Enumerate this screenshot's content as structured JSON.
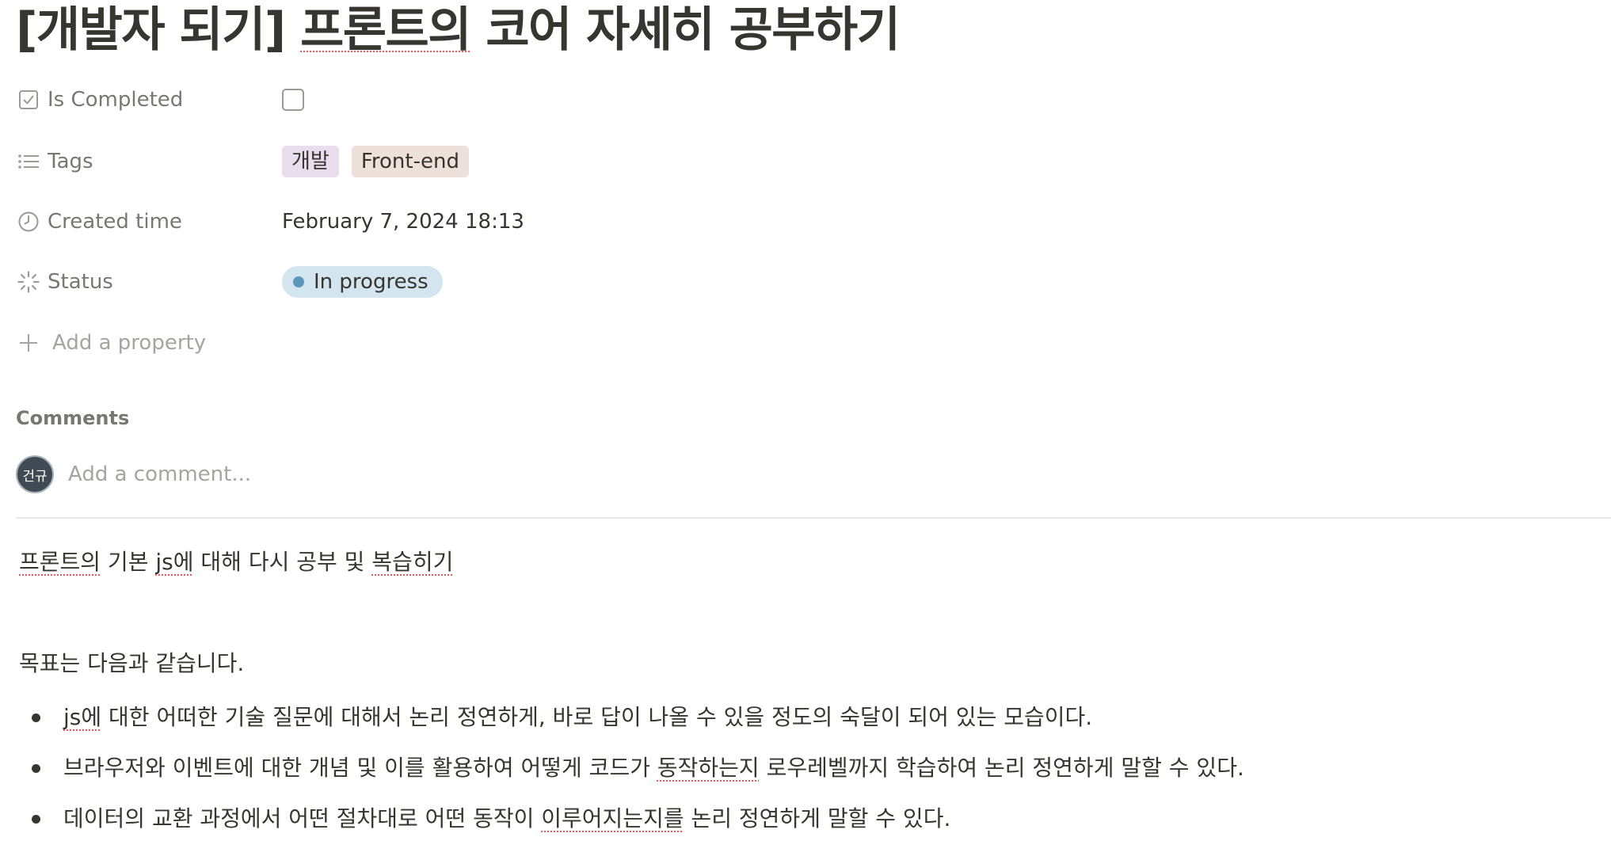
{
  "title": {
    "bracket": "[개발자 되기] ",
    "word_spell": "프론트의",
    "rest": " 코어 자세히 공부하기"
  },
  "properties": [
    {
      "name": "Is Completed",
      "icon": "checkbox-icon",
      "type": "checkbox",
      "checked": false
    },
    {
      "name": "Tags",
      "icon": "list-icon",
      "type": "multi_select",
      "tags": [
        {
          "label": "개발",
          "bg": "#e8deee"
        },
        {
          "label": "Front-end",
          "bg": "#eee0da"
        }
      ]
    },
    {
      "name": "Created time",
      "icon": "clock-icon",
      "type": "created_time",
      "value": "February 7, 2024 18:13"
    },
    {
      "name": "Status",
      "icon": "status-icon",
      "type": "status",
      "value": "In progress",
      "bg": "#d3e5ef",
      "dot_color": "#5b97bd"
    }
  ],
  "add_property_label": "Add a property",
  "comments": {
    "label": "Comments",
    "avatar_initials": "건규",
    "placeholder": "Add a comment..."
  },
  "body": {
    "line1": {
      "spell1": "프론트의",
      "t1": " 기본 ",
      "spell2": "js에",
      "t2": " 대해 다시 공부 및 ",
      "spell3": "복습히기"
    },
    "goal_intro": "목표는 다음과 같습니다.",
    "bullets": [
      {
        "pre": "",
        "spell": "js에",
        "post": " 대한 어떠한 기술 질문에 대해서 논리 정연하게, 바로 답이 나올 수 있을 정도의 숙달이 되어 있는 모습이다."
      },
      {
        "pre": "브라우저와 이벤트에 대한 개념 및 이를 활용하여 어떻게 코드가 ",
        "spell": "동작하는지",
        "post": " 로우레벨까지 학습하여 논리 정연하게 말할 수 있다."
      },
      {
        "pre": "데이터의 교환 과정에서 어떤 절차대로 어떤 동작이 ",
        "spell": "이루어지는지를",
        "post": " 논리 정연하게 말할 수 있다."
      }
    ]
  },
  "colors": {
    "text": "#37352f",
    "muted": "#787774",
    "placeholder": "#a5a4a1",
    "divider": "#e9e9e7",
    "spellcheck": "#eb5757"
  }
}
